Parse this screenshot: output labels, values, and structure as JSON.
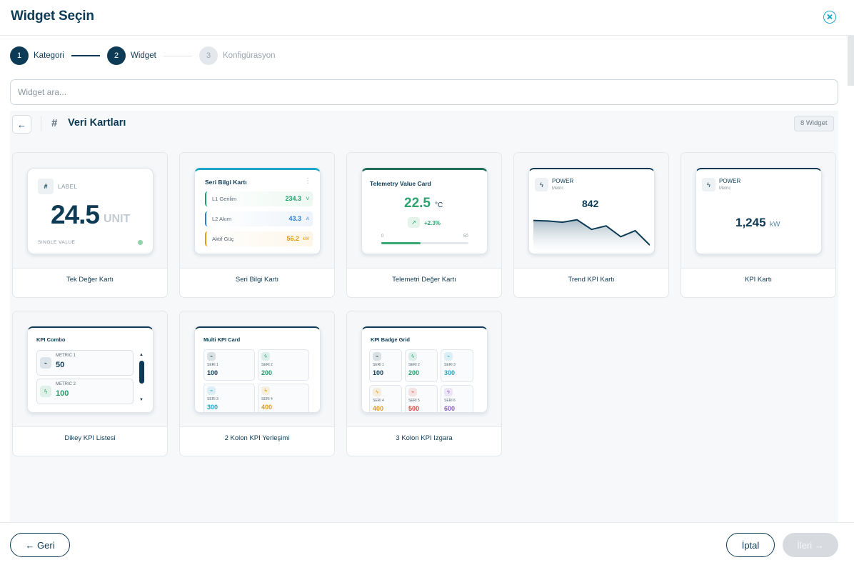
{
  "dialog": {
    "title": "Widget Seçin"
  },
  "stepper": [
    {
      "num": "1",
      "label": "Kategori"
    },
    {
      "num": "2",
      "label": "Widget"
    },
    {
      "num": "3",
      "label": "Konfigürasyon"
    }
  ],
  "search": {
    "placeholder": "Widget ara..."
  },
  "category": {
    "title": "Veri Kartları",
    "count": "8 Widget"
  },
  "widgets": [
    {
      "label": "Tek Değer Kartı"
    },
    {
      "label": "Seri Bilgi Kartı"
    },
    {
      "label": "Telemetri Değer Kartı"
    },
    {
      "label": "Trend KPI Kartı"
    },
    {
      "label": "KPI Kartı"
    },
    {
      "label": "Dikey KPI Listesi"
    },
    {
      "label": "2 Kolon KPI Yerleşimi"
    },
    {
      "label": "3 Kolon KPI Izgara"
    }
  ],
  "previews": {
    "single": {
      "badge": "LABEL",
      "value": "24.5",
      "unit": "UNIT",
      "caption": "SINGLE VALUE"
    },
    "series": {
      "title": "Seri Bilgi Kartı",
      "rows": [
        {
          "label": "L1 Gerilim",
          "value": "234.3",
          "unit": "V",
          "color": "#1f9d6a"
        },
        {
          "label": "L2 Akım",
          "value": "43.3",
          "unit": "A",
          "color": "#2a7fd4"
        },
        {
          "label": "Aktif Güç",
          "value": "56.2",
          "unit": "kW",
          "color": "#e29a16"
        }
      ]
    },
    "telemetry": {
      "title": "Telemetry Value Card",
      "value": "22.5",
      "unit": "°C",
      "change": "+2.3%",
      "min": "0",
      "max": "50",
      "progress": 0.45
    },
    "trend": {
      "title": "POWER",
      "subtitle": "Metric",
      "value": "842",
      "points": [
        55,
        54,
        52,
        56,
        40,
        46,
        28,
        38,
        14
      ]
    },
    "kpi": {
      "title": "POWER",
      "subtitle": "Metric",
      "value": "1,245",
      "unit": "kW"
    },
    "combo": {
      "title": "KPI Combo",
      "items": [
        {
          "label": "METRIC 1",
          "value": "50"
        },
        {
          "label": "METRIC 2",
          "value": "100"
        }
      ]
    },
    "multi": {
      "title": "Multi KPI Card",
      "items": [
        {
          "label": "SERI 1",
          "value": "100",
          "color": "#0d3b55"
        },
        {
          "label": "SERI 2",
          "value": "200",
          "color": "#1f9d6a"
        },
        {
          "label": "SERI 3",
          "value": "300",
          "color": "#1fa7c9"
        },
        {
          "label": "SERI 4",
          "value": "400",
          "color": "#e29a16"
        }
      ]
    },
    "grid": {
      "title": "KPI Badge Grid",
      "items": [
        {
          "label": "SERI 1",
          "value": "100",
          "color": "#0d3b55"
        },
        {
          "label": "SERI 2",
          "value": "200",
          "color": "#1f9d6a"
        },
        {
          "label": "SERI 3",
          "value": "300",
          "color": "#1fa7c9"
        },
        {
          "label": "SERI 4",
          "value": "400",
          "color": "#e29a16"
        },
        {
          "label": "SERI 5",
          "value": "500",
          "color": "#d9433b"
        },
        {
          "label": "SERI 6",
          "value": "600",
          "color": "#8b5cc7"
        }
      ]
    }
  },
  "footer": {
    "back": "← Geri",
    "cancel": "İptal",
    "next": "İleri →"
  }
}
